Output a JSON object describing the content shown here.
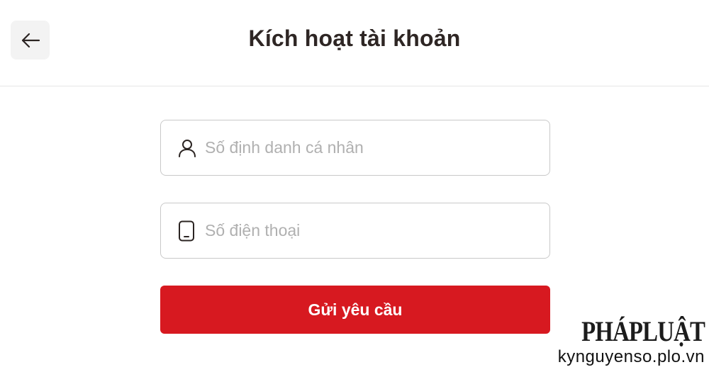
{
  "header": {
    "back_icon": "arrow-left-icon",
    "title": "Kích hoạt tài khoản"
  },
  "form": {
    "id_field": {
      "icon": "user-icon",
      "placeholder": "Số định danh cá nhân",
      "value": ""
    },
    "phone_field": {
      "icon": "phone-icon",
      "placeholder": "Số điện thoại",
      "value": ""
    },
    "submit_label": "Gửi yêu cầu"
  },
  "watermark": {
    "logo_text": "PHÁPLUẬT",
    "url": "kynguyenso.plo.vn"
  },
  "colors": {
    "accent": "#d71920",
    "title_text": "#2e2624",
    "placeholder": "#b0b0b0",
    "border": "#c9c9c9",
    "back_button_bg": "#f3f3f3"
  }
}
